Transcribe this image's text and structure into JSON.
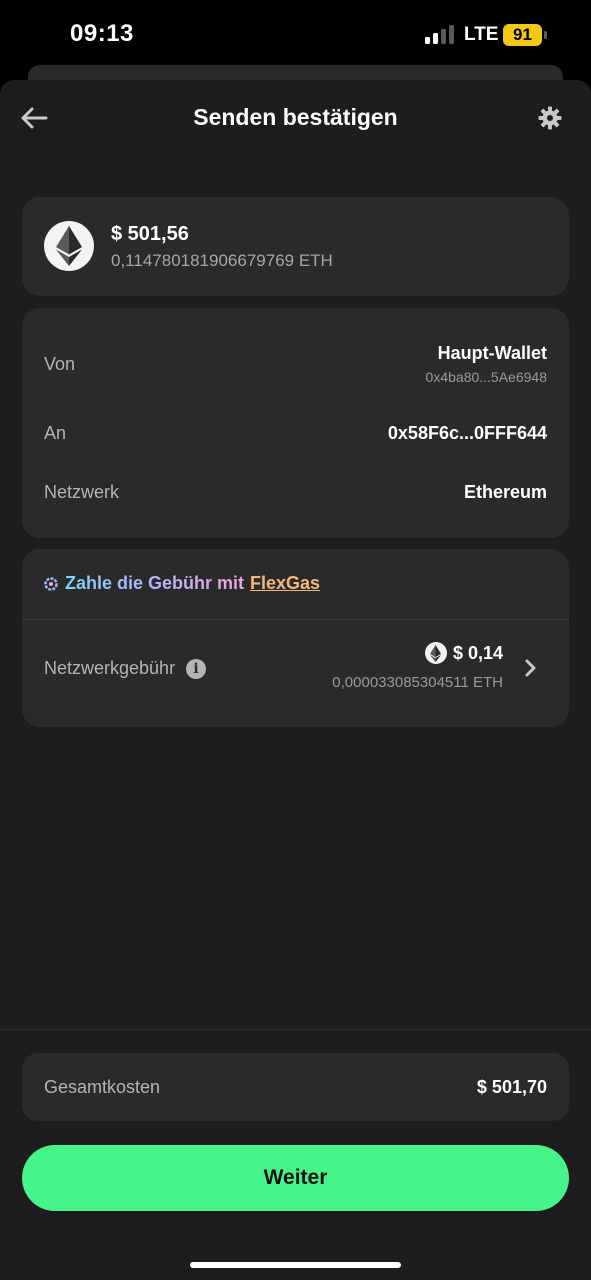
{
  "status_bar": {
    "time": "09:13",
    "network": "LTE",
    "battery": "91"
  },
  "header": {
    "title": "Senden bestätigen",
    "back_icon": "arrow-left-icon",
    "settings_icon": "gear-icon"
  },
  "amount": {
    "usd": "$ 501,56",
    "eth": "0,114780181906679769 ETH",
    "token_icon": "ethereum-icon"
  },
  "details": {
    "from_label": "Von",
    "from_value": "Haupt-Wallet",
    "from_address": "0x4ba80...5Ae6948",
    "to_label": "An",
    "to_value": "0x58F6c...0FFF644",
    "network_label": "Netzwerk",
    "network_value": "Ethereum"
  },
  "fee": {
    "flexgas_text": "Zahle die Gebühr mit",
    "flexgas_link": "FlexGas",
    "label": "Netzwerkgebühr",
    "usd": "$ 0,14",
    "eth": "0,000033085304511 ETH"
  },
  "total": {
    "label": "Gesamtkosten",
    "value": "$ 501,70"
  },
  "actions": {
    "continue_label": "Weiter"
  },
  "colors": {
    "background": "#1d1d1f",
    "card": "#2a2a2c",
    "accent": "#45f58a",
    "battery": "#f5c816"
  }
}
